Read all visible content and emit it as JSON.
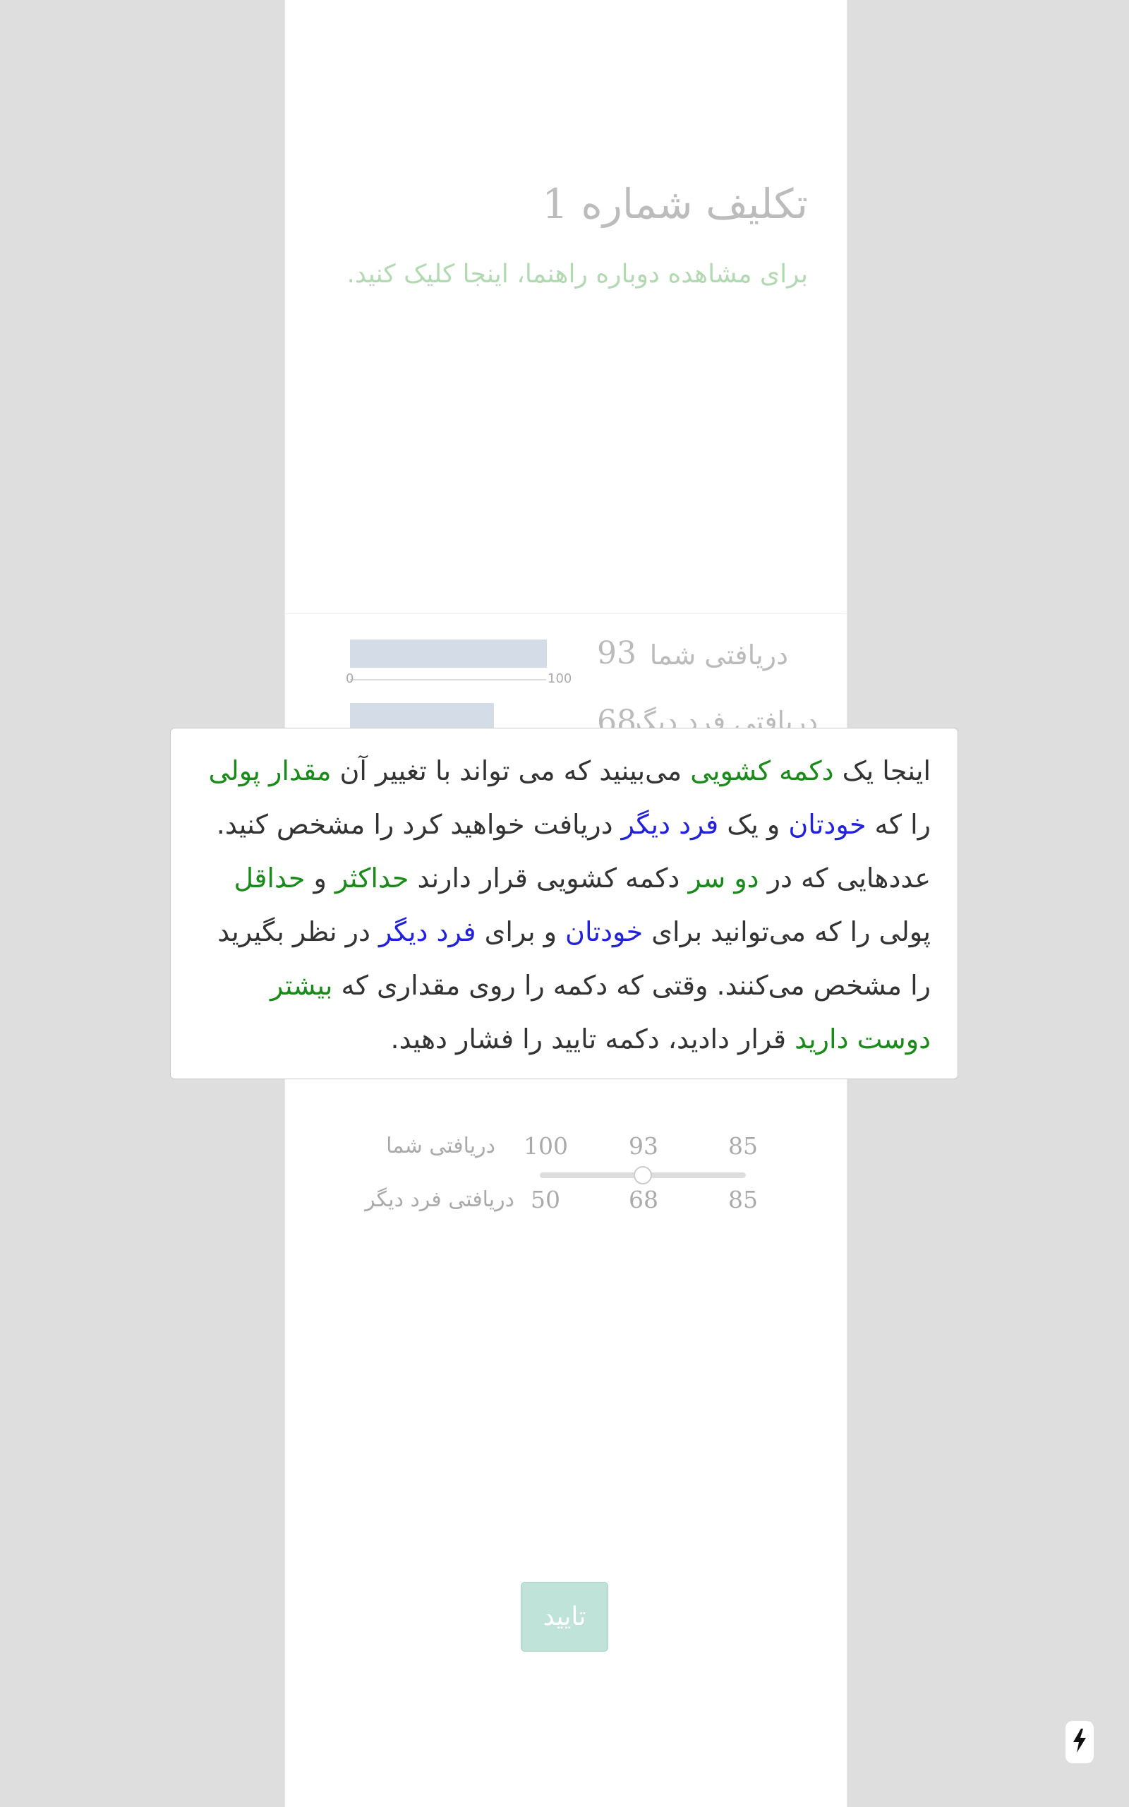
{
  "task": {
    "title": "تکلیف شماره 1",
    "guide_link": "برای مشاهده دوباره راهنما، اینجا کلیک کنید."
  },
  "summary": {
    "self_label": "دریافتی شما",
    "self_value": "93",
    "self_fraction": 0.93,
    "other_label": "دریافتی فرد دیگر",
    "other_value": "68",
    "other_fraction": 0.68,
    "axis_min": "0",
    "axis_max": "100"
  },
  "slider": {
    "self_label": "دریافتی شما",
    "other_label": "دریافتی فرد دیگر",
    "self_left": "100",
    "self_current": "93",
    "self_right": "85",
    "other_left": "50",
    "other_current": "68",
    "other_right": "85",
    "position_fraction": 0.5
  },
  "confirm_button": "تایید",
  "tooltip": {
    "p1": "اینجا یک ",
    "p2": "دکمه کشویی",
    "p3": " می‌بینید که می تواند با تغییر آن ",
    "p4": "مقدار پولی",
    "p5": " را که ",
    "p6": "خودتان",
    "p7": " و یک ",
    "p8": "فرد دیگر",
    "p9": " دریافت خواهید کرد را مشخص کنید. عددهایی که در ",
    "p10": "دو سر",
    "p11": " دکمه کشویی قرار دارند ",
    "p12": "حداکثر",
    "p13": " و ",
    "p14": "حداقل",
    "p15": " پولی را که می‌توانید برای ",
    "p16": "خودتان",
    "p17": " و برای ",
    "p18": "فرد دیگر",
    "p19": " در نظر بگیرید را مشخص می‌کنند. وقتی که دکمه را روی مقداری که ",
    "p20": "بیشتر دوست دارید",
    "p21": " قرار دادید، دکمه تایید را فشار دهید."
  },
  "colors": {
    "highlight_green": "#1a8a1a",
    "highlight_blue": "#2222dd",
    "confirm_bg": "#bfe3d8",
    "bar": "#d3dce7"
  },
  "icons": {
    "floating_button": "bolt-icon"
  }
}
